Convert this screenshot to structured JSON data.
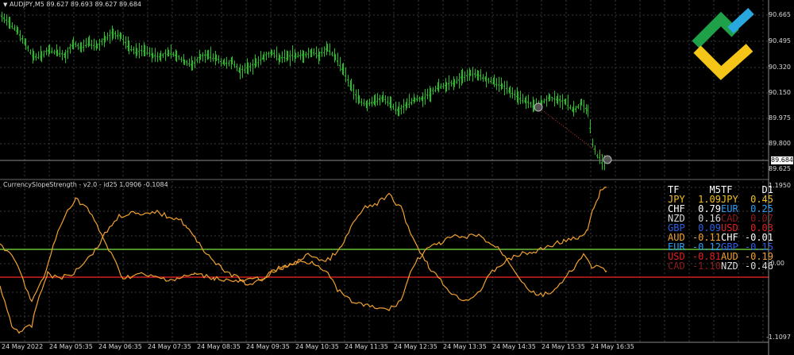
{
  "header": {
    "symbol_text": "AUDJPY,M5  89.627 89.693 89.627 89.684"
  },
  "indicator": {
    "title": "CurrencySlopeStrength - v2.0 - id25 1.0906 -0.1084"
  },
  "price_axis": {
    "labels": [
      "90.665",
      "90.495",
      "90.320",
      "90.150",
      "89.975",
      "89.800",
      "89.625"
    ],
    "current_price": "89.684"
  },
  "indicator_axis": {
    "top": "1.1950",
    "zero": "0.00",
    "bottom": "-1.1097"
  },
  "time_axis": {
    "labels": [
      "24 May 2022",
      "24 May 05:35",
      "24 May 06:35",
      "24 May 07:35",
      "24 May 08:35",
      "24 May 09:35",
      "24 May 10:35",
      "24 May 11:35",
      "24 May 12:35",
      "24 May 13:35",
      "24 May 14:35",
      "24 May 15:35",
      "24 May 16:35"
    ]
  },
  "strength_table": {
    "headers": [
      "TF",
      "M5",
      "TF",
      "D1"
    ],
    "rows": [
      {
        "left": "JPY",
        "left_val": "1.09",
        "left_color": "#f0c020",
        "right": "JPY",
        "right_val": "0.45",
        "right_color": "#f0c020"
      },
      {
        "left": "CHF",
        "left_val": "0.79",
        "left_color": "#ffffff",
        "right": "EUR",
        "right_val": "0.25",
        "right_color": "#2a9df4"
      },
      {
        "left": "NZD",
        "left_val": "0.16",
        "left_color": "#d8d8d8",
        "right": "CAD",
        "right_val": "0.07",
        "right_color": "#8b1a1a"
      },
      {
        "left": "GBP",
        "left_val": "0.09",
        "left_color": "#2b5fe8",
        "right": "USD",
        "right_val": "0.03",
        "right_color": "#e02020"
      },
      {
        "left": "AUD",
        "left_val": "-0.11",
        "left_color": "#f0a030",
        "right": "CHF",
        "right_val": "-0.01",
        "right_color": "#ffffff"
      },
      {
        "left": "EUR",
        "left_val": "-0.12",
        "left_color": "#2a9df4",
        "right": "GBP",
        "right_val": "-0.15",
        "right_color": "#2b5fe8"
      },
      {
        "left": "USD",
        "left_val": "-0.81",
        "left_color": "#e02020",
        "right": "AUD",
        "right_val": "-0.19",
        "right_color": "#f0a030"
      },
      {
        "left": "CAD",
        "left_val": "-1.10",
        "left_color": "#8b1a1a",
        "right": "NZD",
        "right_val": "-0.46",
        "right_color": "#d8d8d8"
      }
    ]
  },
  "colors": {
    "candle": "#22c022",
    "grid": "#2a2a2a",
    "line_orange": "#f0a030",
    "level_green": "#6abf3a",
    "level_red": "#d02020",
    "logo_green": "#1fa14a",
    "logo_yellow": "#f5c518",
    "logo_blue": "#29a8e0"
  }
}
